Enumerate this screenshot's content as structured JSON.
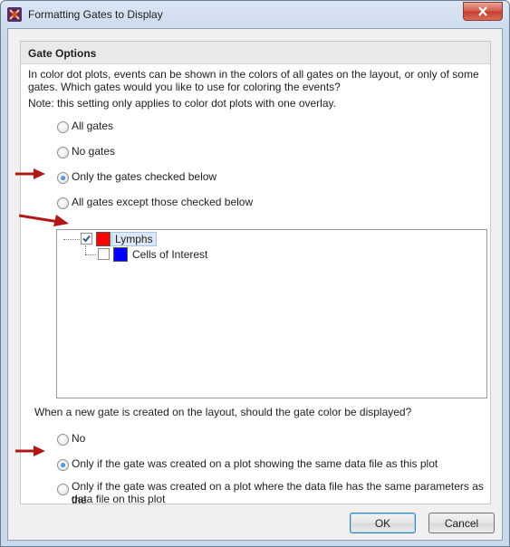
{
  "window": {
    "title": "Formatting Gates to Display",
    "app_icon": "fcs-express-icon",
    "close_icon": "close-icon"
  },
  "group": {
    "title": "Gate Options",
    "description_line1": "In color dot plots, events can be shown in the colors of all gates on the layout, or only of some",
    "description_line2": "gates. Which gates would you like to use for coloring the events?",
    "note": "Note: this setting only applies to color dot plots with one overlay."
  },
  "gate_options": [
    {
      "label": "All gates",
      "checked": false
    },
    {
      "label": "No gates",
      "checked": false
    },
    {
      "label": "Only the gates checked below",
      "checked": true
    },
    {
      "label": "All gates except those checked below",
      "checked": false
    }
  ],
  "gate_tree": [
    {
      "label": "Lymphs",
      "checked": true,
      "color": "#ff0000",
      "selected": true
    },
    {
      "label": "Cells of Interest",
      "checked": false,
      "color": "#0000ff",
      "selected": false
    }
  ],
  "new_gate": {
    "question": "When a new gate is created on the layout, should the gate color be displayed?",
    "options": [
      {
        "label": "No",
        "checked": false
      },
      {
        "label": "Only if the gate was created on a plot showing the same data file as this plot",
        "checked": true
      },
      {
        "label_line1": "Only if the gate was created on a plot where the data file has the same parameters as the",
        "label_line2": "data file on this plot",
        "checked": false
      }
    ]
  },
  "buttons": {
    "ok": "OK",
    "cancel": "Cancel"
  },
  "colors": {
    "annotation_arrow": "#b01818"
  }
}
